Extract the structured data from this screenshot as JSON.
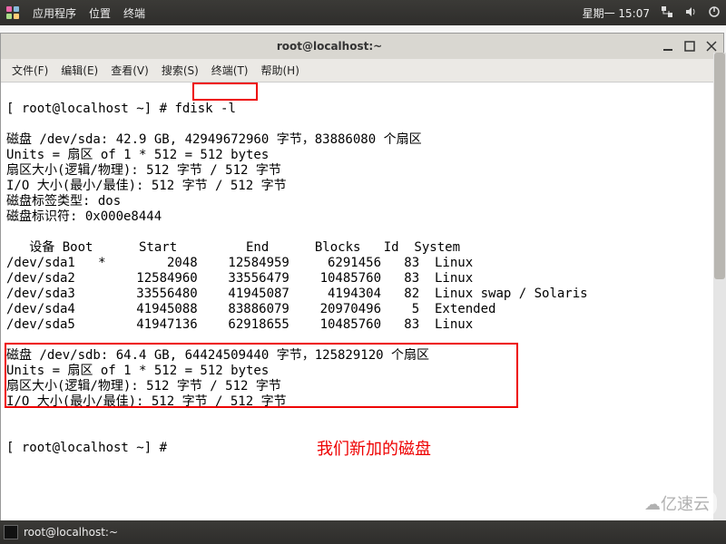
{
  "topbar": {
    "menus": [
      "应用程序",
      "位置",
      "终端"
    ],
    "datetime": "星期一  15:07"
  },
  "window": {
    "title": "root@localhost:~",
    "menubar": [
      "文件(F)",
      "编辑(E)",
      "查看(V)",
      "搜索(S)",
      "终端(T)",
      "帮助(H)"
    ]
  },
  "terminal": {
    "prompt1": "[ root@localhost ~] # ",
    "cmd1": "fdisk -l",
    "blank": " ",
    "sda_header": "磁盘 /dev/sda: 42.9 GB, 42949672960 字节，83886080 个扇区",
    "units": "Units = 扇区 of 1 * 512 = 512 bytes",
    "sector_size": "扇区大小(逻辑/物理): 512 字节 / 512 字节",
    "io_size": "I/O 大小(最小/最佳): 512 字节 / 512 字节",
    "label_type": "磁盘标签类型: dos",
    "label_id": "磁盘标识符: 0x000e8444",
    "table_header": "   设备 Boot      Start         End      Blocks   Id  System",
    "rows": [
      "/dev/sda1   *        2048    12584959     6291456   83  Linux",
      "/dev/sda2        12584960    33556479    10485760   83  Linux",
      "/dev/sda3        33556480    41945087     4194304   82  Linux swap / Solaris",
      "/dev/sda4        41945088    83886079    20970496    5  Extended",
      "/dev/sda5        41947136    62918655    10485760   83  Linux"
    ],
    "sdb_header": "磁盘 /dev/sdb: 64.4 GB, 64424509440 字节，125829120 个扇区",
    "sdb_units": "Units = 扇区 of 1 * 512 = 512 bytes",
    "sdb_sector": "扇区大小(逻辑/物理): 512 字节 / 512 字节",
    "sdb_io": "I/O 大小(最小/最佳): 512 字节 / 512 字节",
    "prompt2": "[ root@localhost ~] # ",
    "annotation": "我们新加的磁盘"
  },
  "taskbar": {
    "label": "root@localhost:~"
  },
  "watermark": "亿速云"
}
